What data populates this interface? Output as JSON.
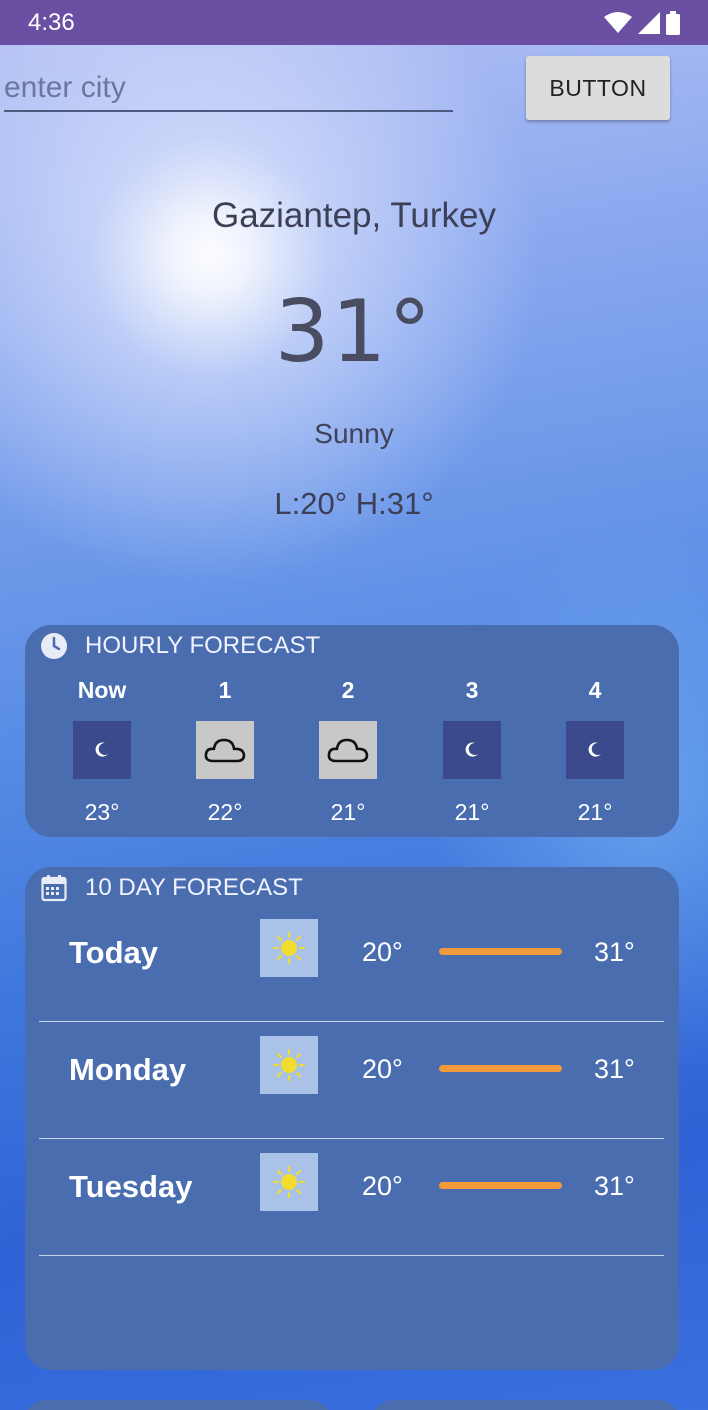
{
  "status_bar": {
    "time": "4:36",
    "icons": [
      "wifi-icon",
      "signal-icon",
      "battery-icon"
    ]
  },
  "search": {
    "placeholder": "enter city",
    "value": "",
    "button_label": "BUTTON"
  },
  "current": {
    "city": "Gaziantep, Turkey",
    "temperature": "31°",
    "condition": "Sunny",
    "low_high": "L:20°  H:31°"
  },
  "hourly": {
    "title": "HOURLY FORECAST",
    "header_icon": "clock-icon",
    "items": [
      {
        "label": "Now",
        "icon": "moon-icon",
        "temp": "23°"
      },
      {
        "label": "1",
        "icon": "cloud-icon",
        "temp": "22°"
      },
      {
        "label": "2",
        "icon": "cloud-icon",
        "temp": "21°"
      },
      {
        "label": "3",
        "icon": "moon-icon",
        "temp": "21°"
      },
      {
        "label": "4",
        "icon": "moon-icon",
        "temp": "21°"
      }
    ]
  },
  "daily": {
    "title": "10 DAY FORECAST",
    "header_icon": "calendar-icon",
    "items": [
      {
        "day": "Today",
        "icon": "sun-icon",
        "low": "20°",
        "high": "31°"
      },
      {
        "day": "Monday",
        "icon": "sun-icon",
        "low": "20°",
        "high": "31°"
      },
      {
        "day": "Tuesday",
        "icon": "sun-icon",
        "low": "20°",
        "high": "31°"
      }
    ]
  },
  "colors": {
    "status_bar": "#6a4fa3",
    "card": "#4a6db0",
    "temp_bar": "#f39a3a",
    "night_tile": "#3a4a8c",
    "cloud_tile": "#c8c8c8",
    "sun_tile": "#a9c2e6"
  }
}
